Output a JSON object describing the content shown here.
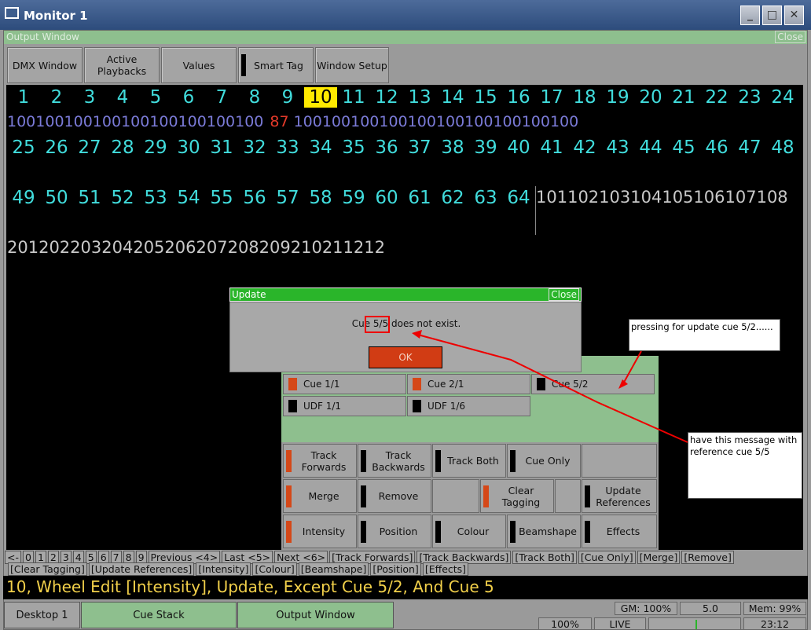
{
  "window": {
    "title": "Monitor 1",
    "min": "_",
    "max": "□",
    "close": "✕"
  },
  "output_bar": {
    "title": "Output Window",
    "close": "Close"
  },
  "toolbar": [
    "DMX Window",
    "Active\nPlaybacks",
    "Values",
    "Smart Tag",
    "Window Setup"
  ],
  "channels": {
    "row1": [
      "1",
      "2",
      "3",
      "4",
      "5",
      "6",
      "7",
      "8",
      "9",
      "10",
      "11",
      "12",
      "13",
      "14",
      "15",
      "16",
      "17",
      "18",
      "19",
      "20",
      "21",
      "22",
      "23",
      "24"
    ],
    "row1_values": [
      "100",
      "100",
      "100",
      "100",
      "100",
      "100",
      "100",
      "100",
      "100",
      "87",
      "100",
      "100",
      "100",
      "100",
      "100",
      "100",
      "100",
      "100",
      "100",
      "100"
    ],
    "row2": [
      "25",
      "26",
      "27",
      "28",
      "29",
      "30",
      "31",
      "32",
      "33",
      "34",
      "35",
      "36",
      "37",
      "38",
      "39",
      "40",
      "41",
      "42",
      "43",
      "44",
      "45",
      "46",
      "47",
      "48"
    ],
    "row3": [
      "49",
      "50",
      "51",
      "52",
      "53",
      "54",
      "55",
      "56",
      "57",
      "58",
      "59",
      "60",
      "61",
      "62",
      "63",
      "64"
    ],
    "row3_extra": "101102103104105106107108",
    "row4": "201202203204205206207208209210211212",
    "highlighted": "10"
  },
  "dialog": {
    "title": "Update",
    "close": "Close",
    "message": "Cue 5/5 does not exist.",
    "ok": "OK"
  },
  "cue_stack": {
    "cues": [
      "Cue 1/1",
      "Cue 2/1",
      "Cue 5/2",
      "UDF 1/1",
      "UDF 1/6"
    ],
    "options": [
      "Track\nForwards",
      "Track\nBackwards",
      "Track Both",
      "Cue Only",
      "Merge",
      "Remove",
      "Clear\nTagging",
      "Update\nReferences",
      "Intensity",
      "Position",
      "Colour",
      "Beamshape",
      "Effects"
    ]
  },
  "notes": {
    "note1": "pressing for update cue 5/2......",
    "note2": "have this message with reference cue 5/5"
  },
  "fkeys_row1": [
    "<-",
    "0",
    "1",
    "2",
    "3",
    "4",
    "5",
    "6",
    "7",
    "8",
    "9",
    "Previous <4>",
    "Last <5>",
    "Next <6>",
    "[Track Forwards]",
    "[Track Backwards]",
    "[Track Both]",
    "[Cue Only]",
    "[Merge]",
    "[Remove]"
  ],
  "fkeys_row2": [
    "[Clear Tagging]",
    "[Update References]",
    "[Intensity]",
    "[Colour]",
    "[Beamshape]",
    "[Position]",
    "[Effects]"
  ],
  "command_line": "10, Wheel Edit [Intensity], Update, Except Cue 5/2, And Cue 5",
  "bottom": {
    "desktop": "Desktop 1",
    "cue_stack": "Cue Stack",
    "output_window": "Output Window"
  },
  "status": {
    "gm": "GM: 100%",
    "rate": "5.0",
    "mem": "Mem: 99%",
    "pct": "100%",
    "live": "LIVE",
    "time": "23:12"
  },
  "colors": {
    "accent_green": "#8ebf8e",
    "dialog_green": "#2ab52a",
    "channel_cyan": "#41dcdc",
    "highlight": "#ffea00",
    "red": "#d13c14"
  }
}
